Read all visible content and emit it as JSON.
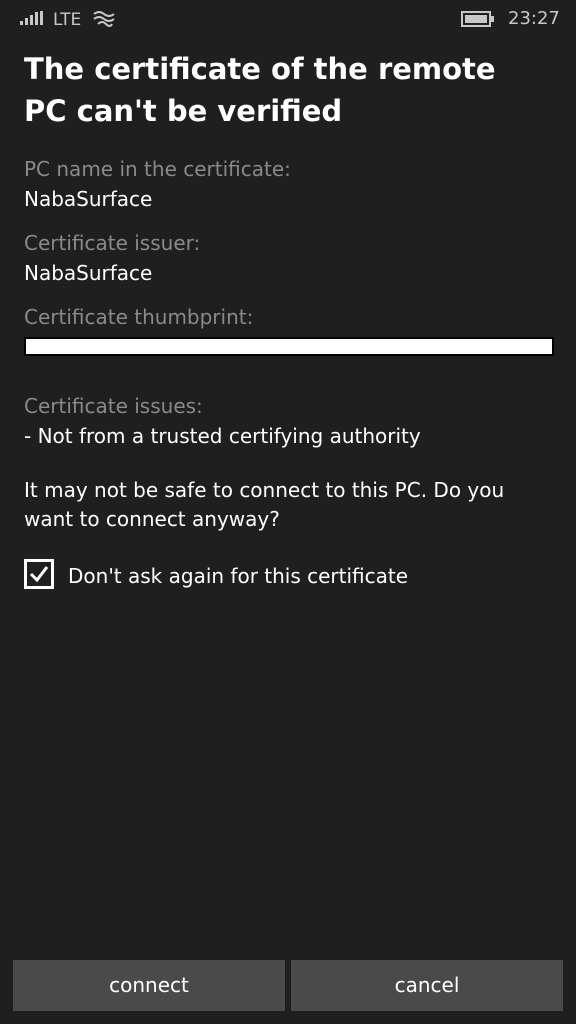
{
  "status_bar": {
    "signal_icon": "signal-bars-icon",
    "network": "LTE",
    "wifi_icon": "wifi-icon",
    "battery_icon": "battery-icon",
    "time": "23:27"
  },
  "dialog": {
    "title": "The certificate of the remote PC can't be verified",
    "pc_name_label": "PC name in the certificate:",
    "pc_name_value": "NabaSurface",
    "issuer_label": "Certificate issuer:",
    "issuer_value": "NabaSurface",
    "thumbprint_label": "Certificate thumbprint:",
    "issues_label": "Certificate issues:",
    "issues_value": "- Not from a trusted certifying authority",
    "warning": "It may not be safe to connect to this PC. Do you want to connect anyway?",
    "checkbox_label": "Don't ask again for this certificate",
    "checkbox_checked": true
  },
  "buttons": {
    "connect": "connect",
    "cancel": "cancel"
  },
  "colors": {
    "background": "#1f1f1f",
    "label": "#8a8a8a",
    "button": "#4a4a4a"
  }
}
